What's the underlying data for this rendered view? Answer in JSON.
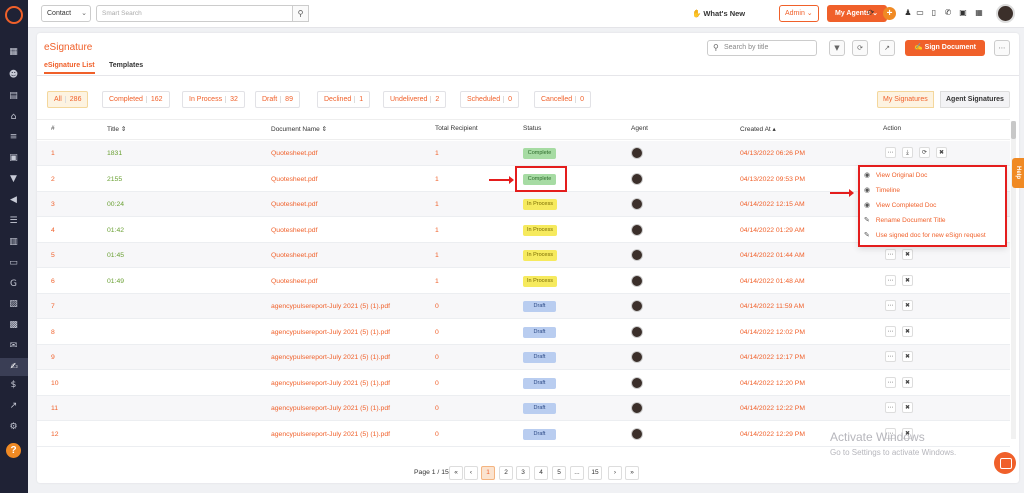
{
  "topbar": {
    "contact_select": "Contact",
    "search_placeholder": "Smart Search",
    "whats_new": "What's New",
    "admin": "Admin",
    "my_agents": "My Agents"
  },
  "page": {
    "title": "eSignature",
    "tabs": [
      "eSignature List",
      "Templates"
    ],
    "search_placeholder": "Search by title",
    "sign_button": "Sign Document"
  },
  "filters": [
    {
      "label": "All",
      "count": "286"
    },
    {
      "label": "Completed",
      "count": "162"
    },
    {
      "label": "In Process",
      "count": "32"
    },
    {
      "label": "Draft",
      "count": "89"
    },
    {
      "label": "Declined",
      "count": "1"
    },
    {
      "label": "Undelivered",
      "count": "2"
    },
    {
      "label": "Scheduled",
      "count": "0"
    },
    {
      "label": "Cancelled",
      "count": "0"
    }
  ],
  "view_toggle": [
    "My Signatures",
    "Agent Signatures"
  ],
  "table": {
    "headers": [
      "#",
      "Title ⇕",
      "Document Name ⇕",
      "Total Recipient",
      "Status",
      "Agent",
      "Created At ▴",
      "Action"
    ],
    "rows": [
      {
        "num": "1",
        "title": "1831",
        "doc": "Quotesheet.pdf",
        "recipients": "1",
        "status": "Complete",
        "created": "04/13/2022 06:26 PM"
      },
      {
        "num": "2",
        "title": "2155",
        "doc": "Quotesheet.pdf",
        "recipients": "1",
        "status": "Complete",
        "created": "04/13/2022 09:53 PM"
      },
      {
        "num": "3",
        "title": "00:24",
        "doc": "Quotesheet.pdf",
        "recipients": "1",
        "status": "In Process",
        "created": "04/14/2022 12:15 AM"
      },
      {
        "num": "4",
        "title": "01:42",
        "doc": "Quotesheet.pdf",
        "recipients": "1",
        "status": "In Process",
        "created": "04/14/2022 01:29 AM"
      },
      {
        "num": "5",
        "title": "01:45",
        "doc": "Quotesheet.pdf",
        "recipients": "1",
        "status": "In Process",
        "created": "04/14/2022 01:44 AM"
      },
      {
        "num": "6",
        "title": "01:49",
        "doc": "Quotesheet.pdf",
        "recipients": "1",
        "status": "In Process",
        "created": "04/14/2022 01:48 AM"
      },
      {
        "num": "7",
        "title": "",
        "doc": "agencypulsereport-July 2021 (5) (1).pdf",
        "recipients": "0",
        "status": "Draft",
        "created": "04/14/2022 11:59 AM"
      },
      {
        "num": "8",
        "title": "",
        "doc": "agencypulsereport-July 2021 (5) (1).pdf",
        "recipients": "0",
        "status": "Draft",
        "created": "04/14/2022 12:02 PM"
      },
      {
        "num": "9",
        "title": "",
        "doc": "agencypulsereport-July 2021 (5) (1).pdf",
        "recipients": "0",
        "status": "Draft",
        "created": "04/14/2022 12:17 PM"
      },
      {
        "num": "10",
        "title": "",
        "doc": "agencypulsereport-July 2021 (5) (1).pdf",
        "recipients": "0",
        "status": "Draft",
        "created": "04/14/2022 12:20 PM"
      },
      {
        "num": "11",
        "title": "",
        "doc": "agencypulsereport-July 2021 (5) (1).pdf",
        "recipients": "0",
        "status": "Draft",
        "created": "04/14/2022 12:22 PM"
      },
      {
        "num": "12",
        "title": "",
        "doc": "agencypulsereport-July 2021 (5) (1).pdf",
        "recipients": "0",
        "status": "Draft",
        "created": "04/14/2022 12:29 PM"
      }
    ]
  },
  "action_menu": [
    {
      "icon": "eye-icon",
      "label": "View Original Doc"
    },
    {
      "icon": "eye-icon",
      "label": "Timeline"
    },
    {
      "icon": "eye-icon",
      "label": "View Completed Doc"
    },
    {
      "icon": "pencil-icon",
      "label": "Rename Document Title"
    },
    {
      "icon": "pencil-icon",
      "label": "Use signed doc for new eSign request"
    }
  ],
  "help_tab": "Help",
  "pagination": {
    "label": "Page 1 / 15",
    "first": "«",
    "prev": "‹",
    "pages": [
      "1",
      "2",
      "3",
      "4",
      "5",
      "...",
      "15"
    ],
    "next": "›",
    "last": "»"
  },
  "watermark": {
    "line1": "Activate Windows",
    "line2": "Go to Settings to activate Windows."
  },
  "colors": {
    "accent": "#f0602a",
    "sidebar": "#1f2235",
    "highlight": "#e41d1d",
    "complete": "#a6dba3",
    "in_process": "#f6ea5e",
    "draft": "#b9cdf0"
  }
}
